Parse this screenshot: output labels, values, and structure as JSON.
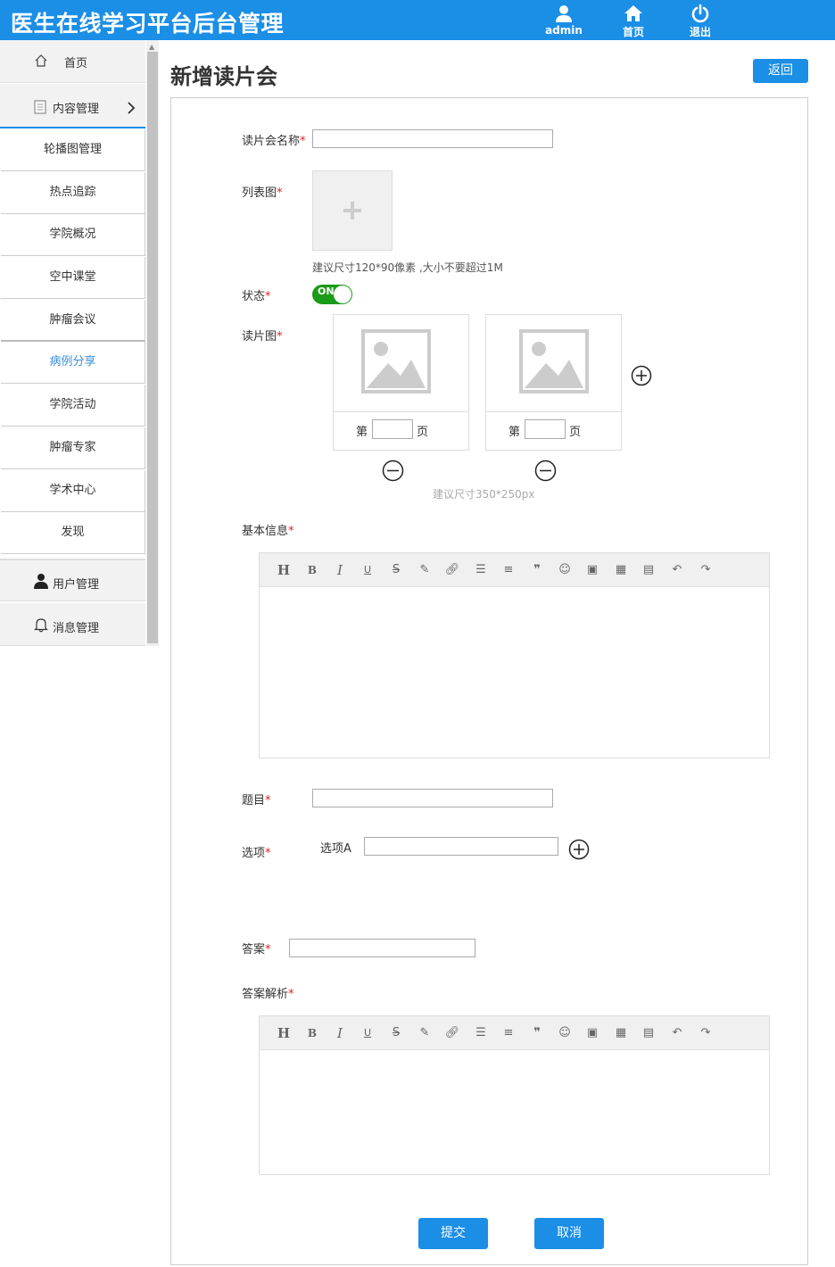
{
  "header": {
    "title": "医生在线学习平台后台管理",
    "user_label": "admin",
    "home_label": "首页",
    "logout_label": "退出"
  },
  "sidebar": {
    "home": "首页",
    "content_mgmt": "内容管理",
    "sub_items": [
      "轮播图管理",
      "热点追踪",
      "学院概况",
      "空中课堂",
      "肿瘤会议",
      "病例分享",
      "学院活动",
      "肿瘤专家",
      "学术中心",
      "发现"
    ],
    "active_item": "病例分享",
    "user_mgmt": "用户管理",
    "message_mgmt": "消息管理"
  },
  "page": {
    "title": "新增读片会",
    "back_label": "返回"
  },
  "form": {
    "name_label": "读片会名称",
    "list_image_label": "列表图",
    "list_image_hint": "建议尺寸120*90像素 ,大小不要超过1M",
    "status_label": "状态",
    "status_toggle": "ON",
    "reading_image_label": "读片图",
    "page_prefix": "第",
    "page_suffix": "页",
    "reading_image_hint": "建议尺寸350*250px",
    "basic_info_label": "基本信息",
    "question_label": "题目",
    "options_label": "选项",
    "option_a_label": "选项A",
    "answer_label": "答案",
    "analysis_label": "答案解析",
    "required_mark": "*"
  },
  "actions": {
    "submit": "提交",
    "cancel": "取消"
  },
  "colors": {
    "brand": "#1b8ee6",
    "toggle_on": "#1a9b1a",
    "required": "#e02020"
  }
}
